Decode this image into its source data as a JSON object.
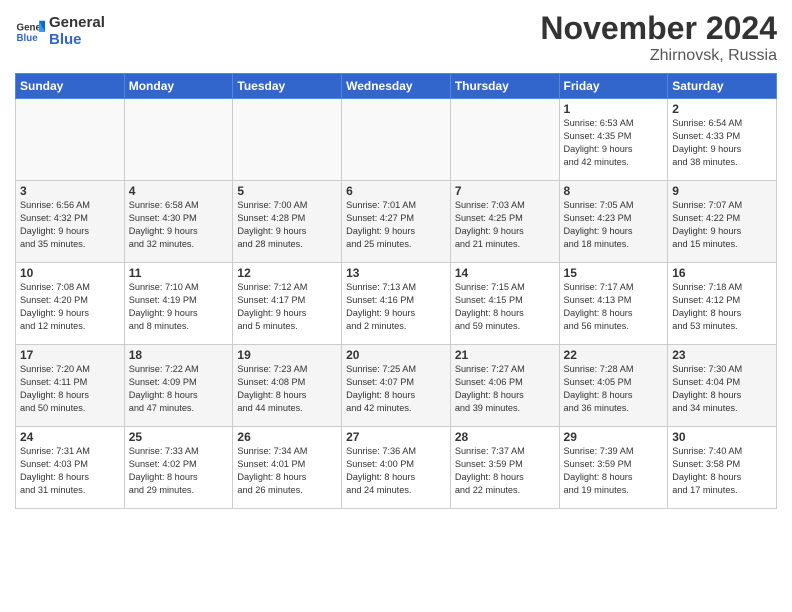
{
  "header": {
    "logo_line1": "General",
    "logo_line2": "Blue",
    "month": "November 2024",
    "location": "Zhirnovsk, Russia"
  },
  "weekdays": [
    "Sunday",
    "Monday",
    "Tuesday",
    "Wednesday",
    "Thursday",
    "Friday",
    "Saturday"
  ],
  "weeks": [
    [
      {
        "day": "",
        "info": ""
      },
      {
        "day": "",
        "info": ""
      },
      {
        "day": "",
        "info": ""
      },
      {
        "day": "",
        "info": ""
      },
      {
        "day": "",
        "info": ""
      },
      {
        "day": "1",
        "info": "Sunrise: 6:53 AM\nSunset: 4:35 PM\nDaylight: 9 hours\nand 42 minutes."
      },
      {
        "day": "2",
        "info": "Sunrise: 6:54 AM\nSunset: 4:33 PM\nDaylight: 9 hours\nand 38 minutes."
      }
    ],
    [
      {
        "day": "3",
        "info": "Sunrise: 6:56 AM\nSunset: 4:32 PM\nDaylight: 9 hours\nand 35 minutes."
      },
      {
        "day": "4",
        "info": "Sunrise: 6:58 AM\nSunset: 4:30 PM\nDaylight: 9 hours\nand 32 minutes."
      },
      {
        "day": "5",
        "info": "Sunrise: 7:00 AM\nSunset: 4:28 PM\nDaylight: 9 hours\nand 28 minutes."
      },
      {
        "day": "6",
        "info": "Sunrise: 7:01 AM\nSunset: 4:27 PM\nDaylight: 9 hours\nand 25 minutes."
      },
      {
        "day": "7",
        "info": "Sunrise: 7:03 AM\nSunset: 4:25 PM\nDaylight: 9 hours\nand 21 minutes."
      },
      {
        "day": "8",
        "info": "Sunrise: 7:05 AM\nSunset: 4:23 PM\nDaylight: 9 hours\nand 18 minutes."
      },
      {
        "day": "9",
        "info": "Sunrise: 7:07 AM\nSunset: 4:22 PM\nDaylight: 9 hours\nand 15 minutes."
      }
    ],
    [
      {
        "day": "10",
        "info": "Sunrise: 7:08 AM\nSunset: 4:20 PM\nDaylight: 9 hours\nand 12 minutes."
      },
      {
        "day": "11",
        "info": "Sunrise: 7:10 AM\nSunset: 4:19 PM\nDaylight: 9 hours\nand 8 minutes."
      },
      {
        "day": "12",
        "info": "Sunrise: 7:12 AM\nSunset: 4:17 PM\nDaylight: 9 hours\nand 5 minutes."
      },
      {
        "day": "13",
        "info": "Sunrise: 7:13 AM\nSunset: 4:16 PM\nDaylight: 9 hours\nand 2 minutes."
      },
      {
        "day": "14",
        "info": "Sunrise: 7:15 AM\nSunset: 4:15 PM\nDaylight: 8 hours\nand 59 minutes."
      },
      {
        "day": "15",
        "info": "Sunrise: 7:17 AM\nSunset: 4:13 PM\nDaylight: 8 hours\nand 56 minutes."
      },
      {
        "day": "16",
        "info": "Sunrise: 7:18 AM\nSunset: 4:12 PM\nDaylight: 8 hours\nand 53 minutes."
      }
    ],
    [
      {
        "day": "17",
        "info": "Sunrise: 7:20 AM\nSunset: 4:11 PM\nDaylight: 8 hours\nand 50 minutes."
      },
      {
        "day": "18",
        "info": "Sunrise: 7:22 AM\nSunset: 4:09 PM\nDaylight: 8 hours\nand 47 minutes."
      },
      {
        "day": "19",
        "info": "Sunrise: 7:23 AM\nSunset: 4:08 PM\nDaylight: 8 hours\nand 44 minutes."
      },
      {
        "day": "20",
        "info": "Sunrise: 7:25 AM\nSunset: 4:07 PM\nDaylight: 8 hours\nand 42 minutes."
      },
      {
        "day": "21",
        "info": "Sunrise: 7:27 AM\nSunset: 4:06 PM\nDaylight: 8 hours\nand 39 minutes."
      },
      {
        "day": "22",
        "info": "Sunrise: 7:28 AM\nSunset: 4:05 PM\nDaylight: 8 hours\nand 36 minutes."
      },
      {
        "day": "23",
        "info": "Sunrise: 7:30 AM\nSunset: 4:04 PM\nDaylight: 8 hours\nand 34 minutes."
      }
    ],
    [
      {
        "day": "24",
        "info": "Sunrise: 7:31 AM\nSunset: 4:03 PM\nDaylight: 8 hours\nand 31 minutes."
      },
      {
        "day": "25",
        "info": "Sunrise: 7:33 AM\nSunset: 4:02 PM\nDaylight: 8 hours\nand 29 minutes."
      },
      {
        "day": "26",
        "info": "Sunrise: 7:34 AM\nSunset: 4:01 PM\nDaylight: 8 hours\nand 26 minutes."
      },
      {
        "day": "27",
        "info": "Sunrise: 7:36 AM\nSunset: 4:00 PM\nDaylight: 8 hours\nand 24 minutes."
      },
      {
        "day": "28",
        "info": "Sunrise: 7:37 AM\nSunset: 3:59 PM\nDaylight: 8 hours\nand 22 minutes."
      },
      {
        "day": "29",
        "info": "Sunrise: 7:39 AM\nSunset: 3:59 PM\nDaylight: 8 hours\nand 19 minutes."
      },
      {
        "day": "30",
        "info": "Sunrise: 7:40 AM\nSunset: 3:58 PM\nDaylight: 8 hours\nand 17 minutes."
      }
    ]
  ]
}
